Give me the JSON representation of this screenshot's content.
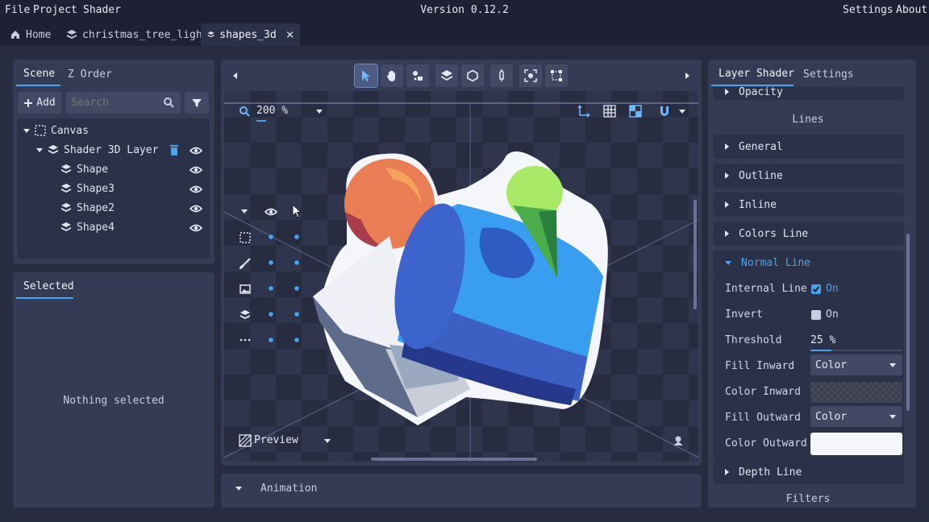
{
  "menubar": {
    "items": [
      "File",
      "Project",
      "Shader"
    ],
    "version": "Version 0.12.2",
    "right_items": [
      "Settings",
      "About"
    ]
  },
  "tabs": [
    {
      "label": "Home",
      "icon": "home-icon"
    },
    {
      "label": "christmas_tree_light...",
      "icon": "layers-icon"
    },
    {
      "label": "shapes_3d",
      "icon": "layers-icon",
      "active": true
    }
  ],
  "scene_panel": {
    "tabs": [
      "Scene",
      "Z Order"
    ],
    "add_label": "Add",
    "search_placeholder": "Search",
    "tree": [
      {
        "label": "Canvas",
        "depth": 0
      },
      {
        "label": "Shader 3D Layer",
        "depth": 1
      },
      {
        "label": "Shape",
        "depth": 2
      },
      {
        "label": "Shape3",
        "depth": 2
      },
      {
        "label": "Shape2",
        "depth": 2
      },
      {
        "label": "Shape4",
        "depth": 2
      }
    ]
  },
  "selected_panel": {
    "tab": "Selected",
    "empty_text": "Nothing selected"
  },
  "viewport": {
    "zoom": "200 %",
    "preview_label": "Preview"
  },
  "animation_panel": {
    "label": "Animation"
  },
  "layer_shader": {
    "tabs": [
      "Layer Shader",
      "Settings"
    ],
    "opacity_label": "Opacity",
    "lines_header": "Lines",
    "sections": [
      "General",
      "Outline",
      "Inline",
      "Colors Line"
    ],
    "open_section": "Normal Line",
    "props": {
      "internal_line": {
        "label": "Internal Line",
        "value": "On",
        "checked": true
      },
      "invert": {
        "label": "Invert",
        "value": "On",
        "checked": false
      },
      "threshold": {
        "label": "Threshold",
        "value": "25 %"
      },
      "fill_inward": {
        "label": "Fill Inward",
        "value": "Color"
      },
      "color_inward": {
        "label": "Color Inward"
      },
      "fill_outward": {
        "label": "Fill Outward",
        "value": "Color"
      },
      "color_outward": {
        "label": "Color Outward"
      }
    },
    "depth_line": "Depth Line",
    "filters_header": "Filters"
  },
  "colors": {
    "accent": "#4aa3f0",
    "panel": "#343b55",
    "background": "#1d2133"
  }
}
